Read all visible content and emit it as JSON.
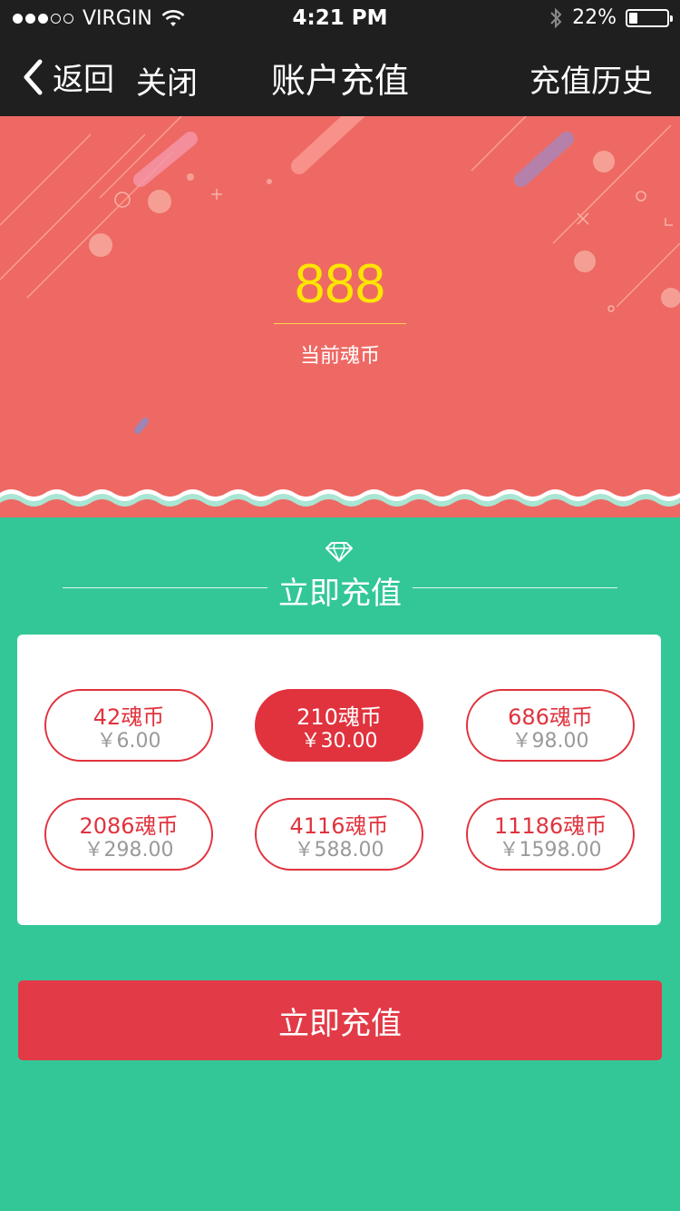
{
  "status_bar": {
    "carrier": "VIRGIN",
    "time": "4:21 PM",
    "battery_percent": "22%",
    "battery_level": 0.22,
    "signal_bars": 3
  },
  "nav": {
    "back_label": "返回",
    "close_label": "关闭",
    "title": "账户充值",
    "history_label": "充值历史"
  },
  "balance": {
    "amount": "888",
    "label": "当前魂币"
  },
  "section": {
    "title": "立即充值"
  },
  "options": [
    {
      "coins": "42魂币",
      "price": "￥6.00",
      "selected": false
    },
    {
      "coins": "210魂币",
      "price": "￥30.00",
      "selected": true
    },
    {
      "coins": "686魂币",
      "price": "￥98.00",
      "selected": false
    },
    {
      "coins": "2086魂币",
      "price": "￥298.00",
      "selected": false
    },
    {
      "coins": "4116魂币",
      "price": "￥588.00",
      "selected": false
    },
    {
      "coins": "11186魂币",
      "price": "￥1598.00",
      "selected": false
    }
  ],
  "button": {
    "label": "立即充值"
  },
  "colors": {
    "hero_bg": "#ee6964",
    "page_bg": "#33c798",
    "accent": "#e0333e",
    "balance_text": "#ffe600",
    "nav_bg": "#1f1f1f"
  }
}
